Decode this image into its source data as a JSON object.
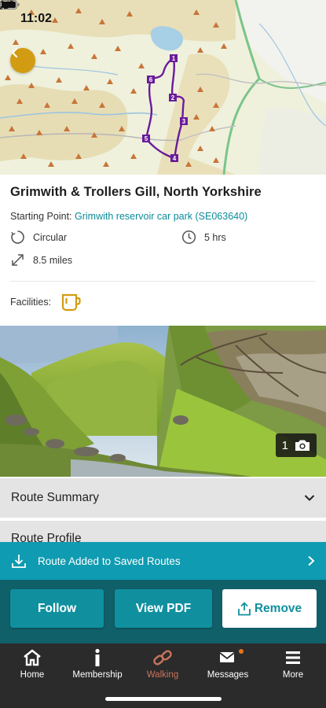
{
  "status_bar": {
    "time": "11:02"
  },
  "map": {
    "waypoints": [
      "1",
      "2",
      "3",
      "4",
      "5",
      "6"
    ]
  },
  "route": {
    "title": "Grimwith & Trollers Gill, North Yorkshire",
    "start_label": "Starting Point:",
    "start_value": "Grimwith reservoir car park (SE063640)",
    "type": "Circular",
    "duration": "5 hrs",
    "distance": "8.5 miles",
    "facilities_label": "Facilities:"
  },
  "photo": {
    "count": "1"
  },
  "sections": {
    "summary": "Route Summary",
    "profile": "Route Profile"
  },
  "banner": {
    "text": "Route Added to Saved Routes"
  },
  "buttons": {
    "follow": "Follow",
    "pdf": "View PDF",
    "remove": "Remove"
  },
  "tabs": [
    {
      "label": "Home"
    },
    {
      "label": "Membership"
    },
    {
      "label": "Walking"
    },
    {
      "label": "Messages"
    },
    {
      "label": "More"
    }
  ],
  "colors": {
    "accent_gold": "#d29c12",
    "teal": "#10909f",
    "banner_teal": "#0f9bb1",
    "route_purple": "#6a1b9a",
    "active_tab": "#c9745e"
  }
}
